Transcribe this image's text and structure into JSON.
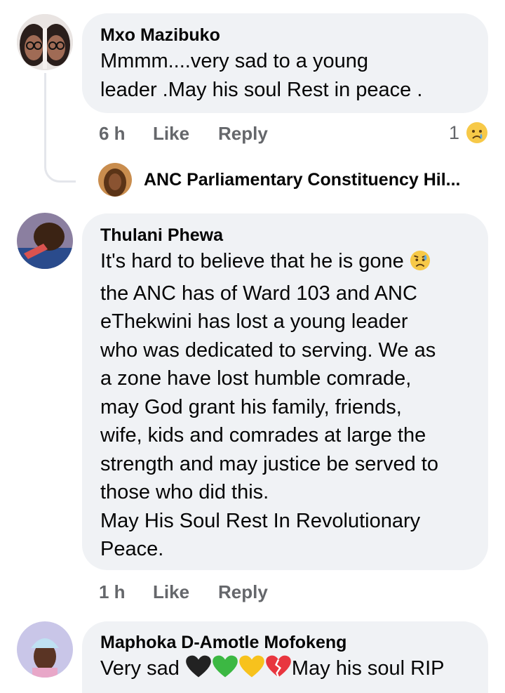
{
  "comments": [
    {
      "author": "Mxo Mazibuko",
      "text_lines": [
        "Mmmm....very sad to a young",
        "leader .May his soul Rest in peace ."
      ],
      "time": "6 h",
      "like": "Like",
      "reply": "Reply",
      "reaction_count": "1",
      "reaction_icon": "crying-face-icon"
    },
    {
      "author": "Thulani Phewa",
      "text_lines": [
        "It's hard to believe that he is gone",
        "the ANC has of Ward 103 and ANC",
        "eThekwini has lost a young leader",
        "who was dedicated to serving. We as",
        "a zone have lost humble comrade,",
        "may God grant his family, friends,",
        "wife, kids and comrades at large the",
        "strength and may justice be served to",
        "those who did this.",
        "May His Soul Rest In Revolutionary",
        "Peace."
      ],
      "time": "1 h",
      "like": "Like",
      "reply": "Reply"
    },
    {
      "author": "Maphoka D-Amotle Mofokeng",
      "text_before": "Very sad ",
      "text_after": "May his soul RIP",
      "hearts": [
        "#222222",
        "#3cb843",
        "#f7c21d",
        "#e8363f"
      ]
    }
  ],
  "reply_preview": {
    "author": "ANC Parliamentary Constituency Hil..."
  }
}
